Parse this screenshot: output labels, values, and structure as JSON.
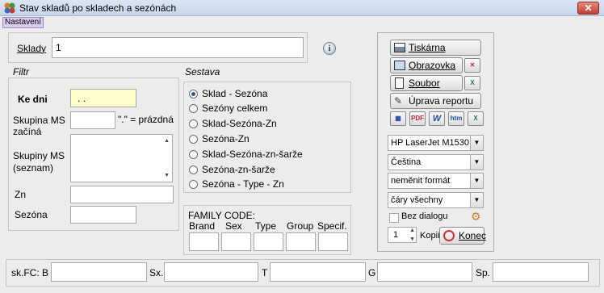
{
  "window": {
    "title": "Stav skladů po skladech a sezónách",
    "close_label": "✕"
  },
  "menu": {
    "item": "Nastavení"
  },
  "sklady": {
    "label": "Sklady",
    "value": "1"
  },
  "filtr": {
    "heading": "Filtr",
    "ke_dni_label": "Ke dni",
    "ke_dni_value": " . .",
    "skupina_label_1": "Skupina MS",
    "skupina_label_2": "začíná",
    "skupina_hint": "\".\" = prázdná",
    "skupiny_label_1": "Skupiny MS",
    "skupiny_label_2": "(seznam)",
    "zn_label": "Zn",
    "sezona_label": "Sezóna"
  },
  "sestava": {
    "heading": "Sestava",
    "options": [
      "Sklad - Sezóna",
      "Sezóny celkem",
      "Sklad-Sezóna-Zn",
      "Sezóna-Zn",
      "Sklad-Sezóna-zn-šarže",
      "Sezóna-zn-šarže",
      "Sezóna - Type - Zn"
    ]
  },
  "family": {
    "heading": "FAMILY CODE:",
    "cols": [
      "Brand",
      "Sex",
      "Type",
      "Group",
      "Specif."
    ]
  },
  "actions": {
    "tiskarna": "Tiskárna",
    "obrazovka": "Obrazovka",
    "soubor": "Soubor",
    "uprava": "Úprava reportu",
    "printer": "HP LaserJet M1530",
    "language": "Čeština",
    "format": "neměnit formát",
    "lines": "čáry všechny",
    "bez_dialogu": "Bez dialogu",
    "kopii_value": "1",
    "kopii_label": "Kopií",
    "konec": "Konec",
    "export_icons": [
      "table-icon",
      "pdf-icon",
      "word-icon",
      "html-icon",
      "excel-icon"
    ]
  },
  "bottom": {
    "skfc_label": "sk.FC: B",
    "sx_label": "Sx.",
    "t_label": "T",
    "g_label": "G",
    "sp_label": "Sp."
  },
  "colors": {
    "date_field_bg": "#ffffcc",
    "excel_green": "#1f7a3a",
    "pdf_red": "#c62828",
    "word_blue": "#1e4fa8"
  }
}
